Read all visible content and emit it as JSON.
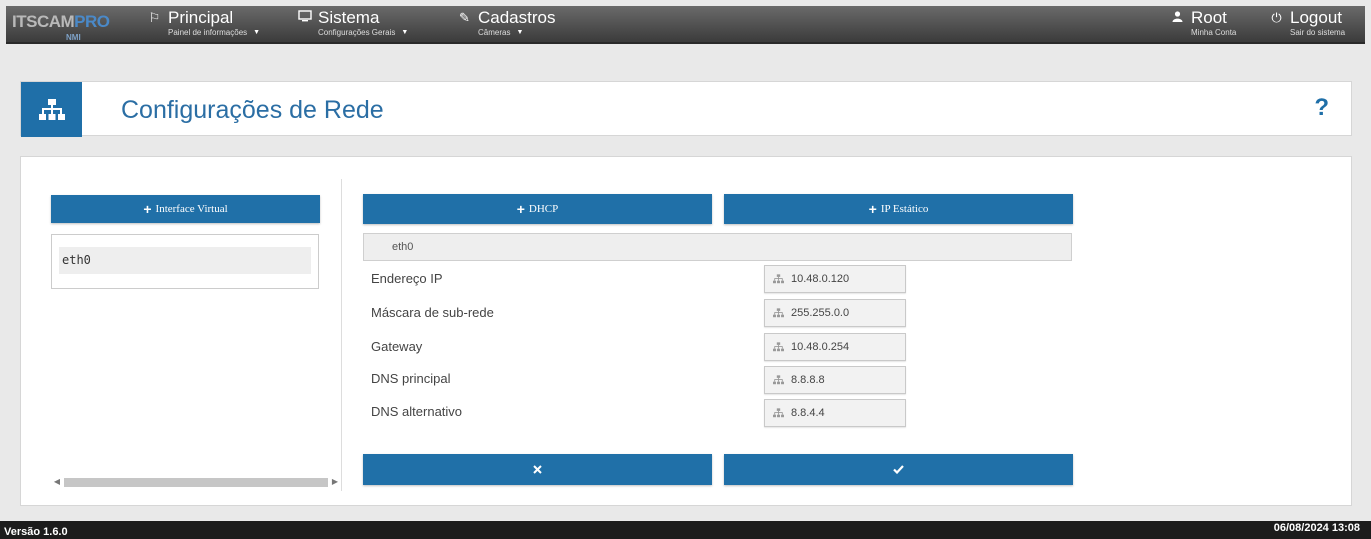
{
  "nav": {
    "logo_main": "ITSCAM",
    "logo_pro": "PRO",
    "logo_sub": "NMI",
    "items": [
      {
        "label": "Principal",
        "sub": "Painel de informações",
        "icon": "flag-icon"
      },
      {
        "label": "Sistema",
        "sub": "Configurações Gerais",
        "icon": "monitor-icon"
      },
      {
        "label": "Cadastros",
        "sub": "Câmeras",
        "icon": "edit-icon"
      }
    ],
    "user": {
      "label": "Root",
      "sub": "Minha Conta",
      "icon": "user-icon"
    },
    "logout": {
      "label": "Logout",
      "sub": "Sair do sistema",
      "icon": "power-icon"
    }
  },
  "header": {
    "title": "Configurações de Rede",
    "help_label": "?",
    "icon": "network-icon"
  },
  "left_panel": {
    "add_button_label": "Interface Virtual",
    "interfaces": [
      "eth0"
    ]
  },
  "right_panel": {
    "dhcp_label": "DHCP",
    "static_label": "IP Estático",
    "interface_name": "eth0",
    "fields": [
      {
        "label": "Endereço IP",
        "value": "10.48.0.120"
      },
      {
        "label": "Máscara de sub-rede",
        "value": "255.255.0.0"
      },
      {
        "label": "Gateway",
        "value": "10.48.0.254"
      },
      {
        "label": "DNS principal",
        "value": "8.8.8.8"
      },
      {
        "label": "DNS alternativo",
        "value": "8.8.4.4"
      }
    ],
    "cancel_icon": "close-icon",
    "confirm_icon": "check-icon"
  },
  "footer": {
    "version": "Versão  1.6.0",
    "datetime": "06/08/2024 13:08"
  },
  "colors": {
    "accent": "#2070a8",
    "title": "#2b6ea4",
    "topbar": "#4a4a4a"
  }
}
